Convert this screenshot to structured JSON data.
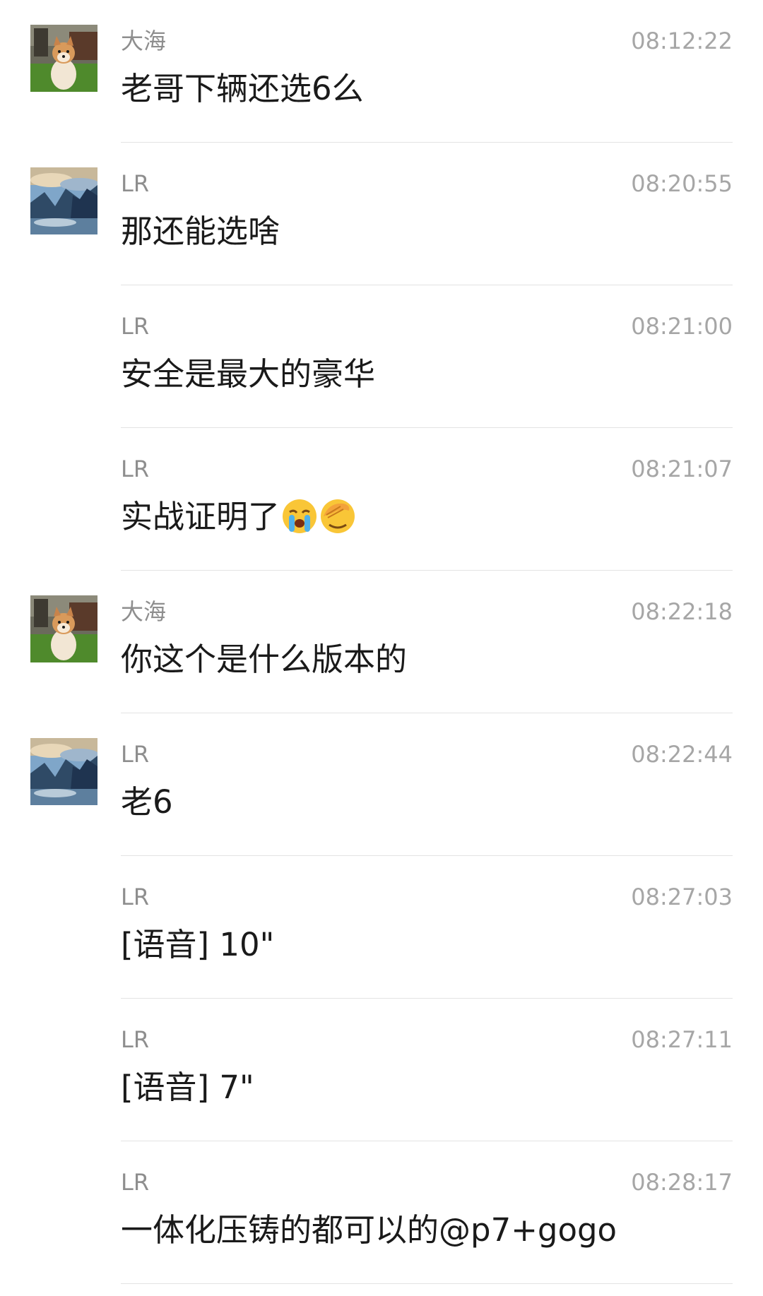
{
  "messages": [
    {
      "sender": "大海",
      "time": "08:12:22",
      "text": "老哥下辆还选6么",
      "avatar": "shiba-dog-avatar"
    },
    {
      "sender": "LR",
      "time": "08:20:55",
      "text": "那还能选啥",
      "avatar": "mountain-landscape-avatar"
    },
    {
      "sender": "LR",
      "time": "08:21:00",
      "text": "安全是最大的豪华"
    },
    {
      "sender": "LR",
      "time": "08:21:07",
      "text": "实战证明了",
      "emojis": [
        "loudly-crying-face-icon",
        "facepalm-face-icon"
      ]
    },
    {
      "sender": "大海",
      "time": "08:22:18",
      "text": "你这个是什么版本的",
      "avatar": "shiba-dog-avatar"
    },
    {
      "sender": "LR",
      "time": "08:22:44",
      "text": "老6",
      "avatar": "mountain-landscape-avatar"
    },
    {
      "sender": "LR",
      "time": "08:27:03",
      "text": "[语音] 10\""
    },
    {
      "sender": "LR",
      "time": "08:27:11",
      "text": "[语音] 7\""
    },
    {
      "sender": "LR",
      "time": "08:28:17",
      "text": "一体化压铸的都可以的@p7+gogo"
    }
  ],
  "colors": {
    "sender": "#8e8e8e",
    "time": "#a6a6a6",
    "text": "#1a1a1a",
    "divider": "#e3e3e3"
  }
}
